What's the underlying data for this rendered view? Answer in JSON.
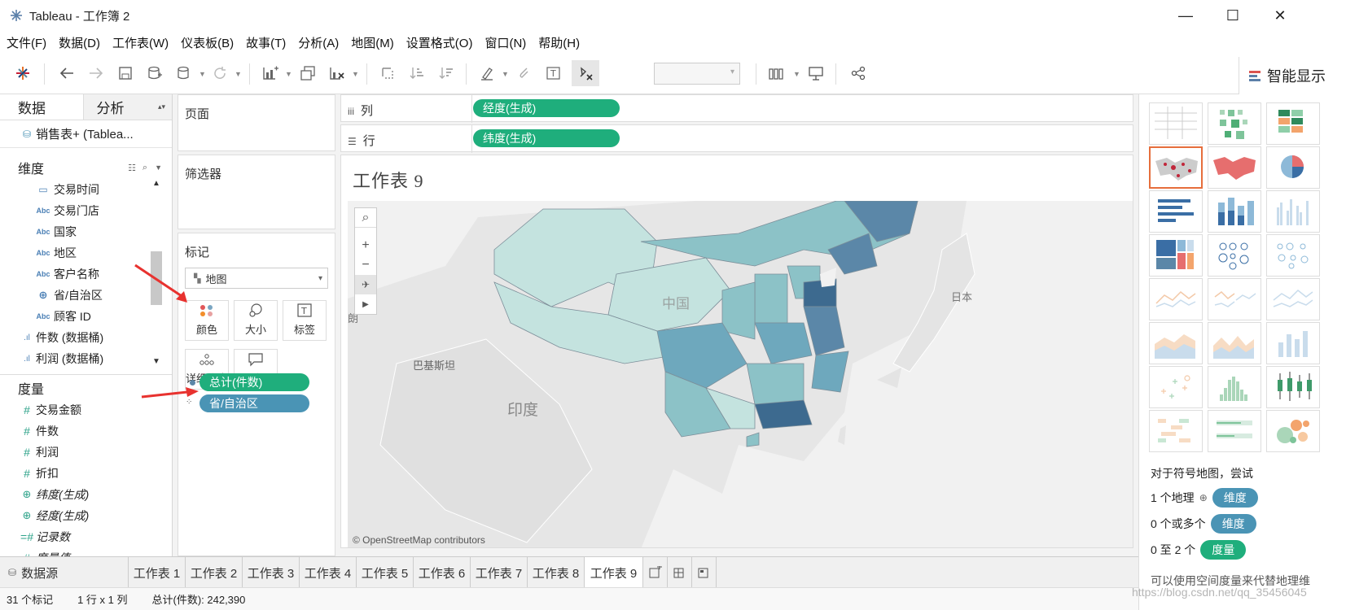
{
  "window": {
    "title": "Tableau - 工作簿 2",
    "minimize": "—",
    "maximize": "☐",
    "close": "✕"
  },
  "menu": [
    "文件(F)",
    "数据(D)",
    "工作表(W)",
    "仪表板(B)",
    "故事(T)",
    "分析(A)",
    "地图(M)",
    "设置格式(O)",
    "窗口(N)",
    "帮助(H)"
  ],
  "toolbar": {
    "smart_show": "智能显示"
  },
  "data_pane": {
    "tab_data": "数据",
    "tab_analysis": "分析",
    "datasource": "销售表+ (Tablea...",
    "dimensions_header": "维度",
    "dimensions": [
      {
        "type": "date",
        "label": "交易时间"
      },
      {
        "type": "Abc",
        "label": "交易门店"
      },
      {
        "type": "Abc",
        "label": "国家"
      },
      {
        "type": "Abc",
        "label": "地区"
      },
      {
        "type": "Abc",
        "label": "客户名称"
      },
      {
        "type": "globe",
        "label": "省/自治区"
      },
      {
        "type": "Abc",
        "label": "顾客 ID"
      },
      {
        "type": "bin",
        "label": "件数 (数据桶)"
      },
      {
        "type": "bin",
        "label": "利润 (数据桶)"
      }
    ],
    "measures_header": "度量",
    "measures": [
      {
        "type": "#",
        "label": "交易金额",
        "italic": false
      },
      {
        "type": "#",
        "label": "件数",
        "italic": false
      },
      {
        "type": "#",
        "label": "利润",
        "italic": false
      },
      {
        "type": "#",
        "label": "折扣",
        "italic": false
      },
      {
        "type": "globe",
        "label": "纬度(生成)",
        "italic": true
      },
      {
        "type": "globe",
        "label": "经度(生成)",
        "italic": true
      },
      {
        "type": "#",
        "label": "记录数",
        "italic": true
      },
      {
        "type": "#",
        "label": "度量值",
        "italic": true
      }
    ]
  },
  "cards": {
    "pages": "页面",
    "filters": "筛选器",
    "marks": "标记",
    "mark_type": "地图",
    "buttons": {
      "color": "颜色",
      "size": "大小",
      "label": "标签",
      "detail": "详细信息",
      "tooltip": "工具提示"
    },
    "pill_color": "总计(件数)",
    "pill_detail": "省/自治区"
  },
  "shelves": {
    "columns_label": "列",
    "columns_icon": "iii",
    "columns_pill": "经度(生成)",
    "rows_label": "行",
    "rows_icon": "☰",
    "rows_pill": "纬度(生成)"
  },
  "view": {
    "title": "工作表 9",
    "map_labels": {
      "china": "中国",
      "japan": "日本",
      "pakistan": "巴基斯坦",
      "india": "印度",
      "edge": "朗"
    },
    "credit": "© OpenStreetMap contributors",
    "colors": {
      "light": "#c4e3df",
      "mid": "#8cc2c7",
      "dark": "#3d6a8f"
    }
  },
  "show_me": {
    "hint_title": "对于符号地图，尝试",
    "hint1_prefix": "1 个地理",
    "hint1_tag": "维度",
    "hint2_prefix": "0 个或多个",
    "hint2_tag": "维度",
    "hint3_prefix": "0 至 2 个",
    "hint3_tag": "度量",
    "hint4": "可以使用空间度量来代替地理维"
  },
  "bottom_tabs": [
    "数据源",
    "工作表 1",
    "工作表 2",
    "工作表 3",
    "工作表 4",
    "工作表 5",
    "工作表 6",
    "工作表 7",
    "工作表 8",
    "工作表 9"
  ],
  "status": {
    "marks": "31 个标记",
    "rows_cols": "1 行 x 1 列",
    "total": "总计(件数): 242,390"
  },
  "watermark": "https://blog.csdn.net/qq_35456045",
  "accent": {
    "green_pill": "#1fae7c",
    "blue_pill": "#4a94b5",
    "arrow_red": "#e8322f"
  }
}
